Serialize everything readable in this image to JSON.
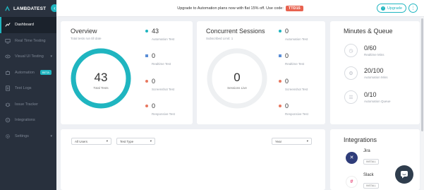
{
  "brand": {
    "name": "LAMBDATEST",
    "collapse_icon": "chevron-left-icon"
  },
  "sidebar": {
    "items": [
      {
        "label": "Dashboard",
        "icon": "dashboard-icon",
        "active": true
      },
      {
        "label": "Real Time Testing",
        "icon": "monitor-icon"
      },
      {
        "label": "Visual UI Testing",
        "icon": "eye-icon",
        "caret": true
      },
      {
        "label": "Automation",
        "icon": "robot-icon",
        "badge": "BETA"
      },
      {
        "label": "Test Logs",
        "icon": "logs-icon"
      },
      {
        "label": "Issue Tracker",
        "icon": "bug-icon"
      },
      {
        "label": "Integrations",
        "icon": "plug-icon"
      },
      {
        "label": "Settings",
        "icon": "gear-icon",
        "caret": true
      }
    ]
  },
  "topbar": {
    "promo_text": "Upgrade to Automation plans now with flat 15% off. Use code:",
    "promo_code": "TTD15",
    "upgrade_label": "Upgrade",
    "menu_icon": "menu-dots-icon"
  },
  "overview": {
    "title": "Overview",
    "subtitle": "Total tests run till date",
    "total": "43",
    "total_label": "Total Tests",
    "stats": [
      {
        "value": "43",
        "label": "Automation Test",
        "color": "#1fb5c0"
      },
      {
        "value": "0",
        "label": "Realtime Test",
        "color": "#5b8ed6"
      },
      {
        "value": "0",
        "label": "Screenshot Test",
        "color": "#e8785f"
      },
      {
        "value": "0",
        "label": "Responsive Test",
        "color": "#e8785f"
      }
    ]
  },
  "concurrent": {
    "title": "Concurrent Sessions",
    "subtitle": "Subscribed Limit: 1",
    "total": "0",
    "total_label": "Sessions Live",
    "stats": [
      {
        "value": "0",
        "label": "Automation Test",
        "color": "#1fb5c0"
      },
      {
        "value": "0",
        "label": "Realtime Test",
        "color": "#5b8ed6"
      },
      {
        "value": "0",
        "label": "Screenshot Test",
        "color": "#e8785f"
      },
      {
        "value": "0",
        "label": "Responsive Test",
        "color": "#e8785f"
      }
    ]
  },
  "minutes": {
    "title": "Minutes & Queue",
    "rows": [
      {
        "value": "0/60",
        "label": "Realtime Mins",
        "icon": "clock-icon"
      },
      {
        "value": "20/100",
        "label": "Automation Mins",
        "icon": "robot-icon"
      },
      {
        "value": "0/10",
        "label": "Automation Queue",
        "icon": "queue-icon"
      }
    ]
  },
  "filters": {
    "users": "All Users",
    "test_type": "Test Type",
    "period": "Year"
  },
  "integrations": {
    "title": "Integrations",
    "items": [
      {
        "name": "Jira",
        "action": "INSTALL",
        "color": "#2f3d7a",
        "icon": "jira-icon"
      },
      {
        "name": "Slack",
        "action": "INSTALL",
        "color": "#ffffff",
        "icon": "slack-icon"
      }
    ]
  },
  "chat": {
    "icon": "chat-icon"
  }
}
